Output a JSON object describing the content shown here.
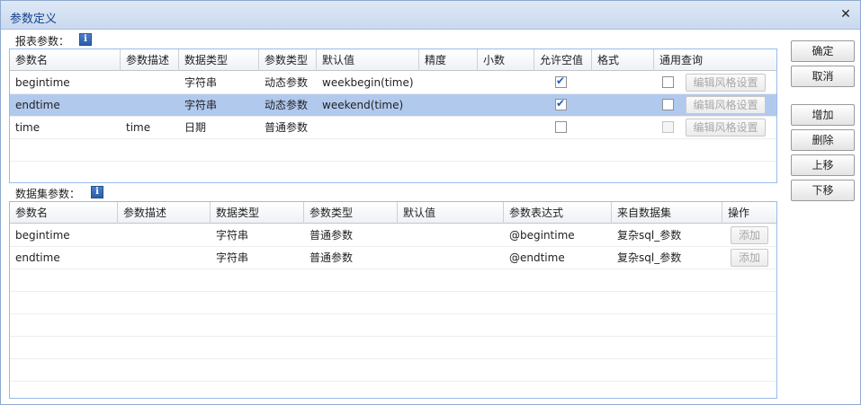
{
  "dialog": {
    "title": "参数定义",
    "close_glyph": "✕"
  },
  "report_params": {
    "label": "报表参数：",
    "info_glyph": "i",
    "headers": [
      "参数名",
      "参数描述",
      "数据类型",
      "参数类型",
      "默认值",
      "精度",
      "小数",
      "允许空值",
      "格式",
      "通用查询"
    ],
    "rows": [
      {
        "name": "begintime",
        "desc": "",
        "data_type": "字符串",
        "param_type": "动态参数",
        "default": "weekbegin(time)",
        "precision": "",
        "decimal": "",
        "allow_null": true,
        "format": "",
        "general_query": false,
        "style_button": "编辑风格设置",
        "selected": false
      },
      {
        "name": "endtime",
        "desc": "",
        "data_type": "字符串",
        "param_type": "动态参数",
        "default": "weekend(time)",
        "precision": "",
        "decimal": "",
        "allow_null": true,
        "format": "",
        "general_query": false,
        "style_button": "编辑风格设置",
        "selected": true
      },
      {
        "name": "time",
        "desc": "time",
        "data_type": "日期",
        "param_type": "普通参数",
        "default": "",
        "precision": "",
        "decimal": "",
        "allow_null": false,
        "format": "",
        "general_query": false,
        "style_button": "编辑风格设置",
        "selected": false
      }
    ]
  },
  "dataset_params": {
    "label": "数据集参数：",
    "info_glyph": "i",
    "headers": [
      "参数名",
      "参数描述",
      "数据类型",
      "参数类型",
      "默认值",
      "参数表达式",
      "来自数据集",
      "操作"
    ],
    "rows": [
      {
        "name": "begintime",
        "desc": "",
        "data_type": "字符串",
        "param_type": "普通参数",
        "default": "",
        "expression": "@begintime",
        "dataset": "复杂sql_参数",
        "action": "添加"
      },
      {
        "name": "endtime",
        "desc": "",
        "data_type": "字符串",
        "param_type": "普通参数",
        "default": "",
        "expression": "@endtime",
        "dataset": "复杂sql_参数",
        "action": "添加"
      }
    ]
  },
  "buttons": {
    "ok": "确定",
    "cancel": "取消",
    "add": "增加",
    "delete": "删除",
    "move_up": "上移",
    "move_down": "下移"
  }
}
